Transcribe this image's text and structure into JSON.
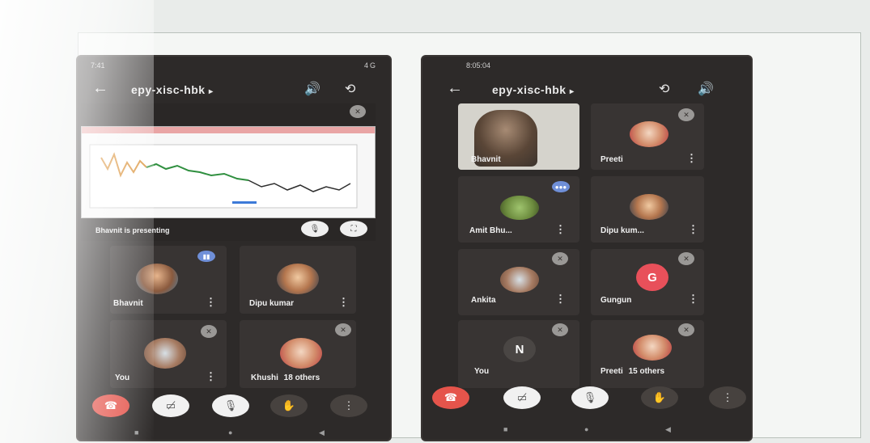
{
  "left_phone": {
    "status": {
      "time": "7:41",
      "right_icons": "4G"
    },
    "room_code": "epy-xisc-hbk",
    "room_chevron": "▸",
    "icons": {
      "back": "arrow-back-icon",
      "audio": "speaker-icon",
      "switch": "camera-switch-icon"
    },
    "presenting_text": "Bhavnit is presenting",
    "participants": [
      {
        "name": "Bhavnit",
        "state": "speaking"
      },
      {
        "name": "Dipu kumar",
        "state": "muted"
      },
      {
        "name": "You",
        "state": "muted"
      },
      {
        "name": "Khushi",
        "others": "18 others",
        "state": "muted"
      }
    ],
    "controls": [
      "end-call",
      "camera-off",
      "mic-off",
      "raise-hand",
      "more"
    ]
  },
  "right_phone": {
    "status": {
      "time": "8:05:04"
    },
    "room_code": "epy-xisc-hbk",
    "room_chevron": "▸",
    "participants": [
      {
        "name": "Bhavnit",
        "state": "video"
      },
      {
        "name": "Preeti",
        "state": "muted"
      },
      {
        "name": "Amit Bhu...",
        "state": "speaking"
      },
      {
        "name": "Dipu kum...",
        "state": "muted"
      },
      {
        "name": "Ankita",
        "state": "muted"
      },
      {
        "name": "Gungun",
        "initial": "G",
        "state": "muted"
      },
      {
        "name": "You",
        "initial": "N",
        "state": "muted"
      },
      {
        "name": "Preeti",
        "others": "15 others",
        "state": "muted"
      }
    ],
    "controls": [
      "end-call",
      "camera-off",
      "mic-off",
      "raise-hand",
      "more"
    ]
  },
  "colors": {
    "phone_bg": "#2d2a29",
    "tile_bg": "#383433",
    "end_call": "#e5544b",
    "gungun_avatar": "#e8505a",
    "you_avatar": "#4a4644"
  }
}
